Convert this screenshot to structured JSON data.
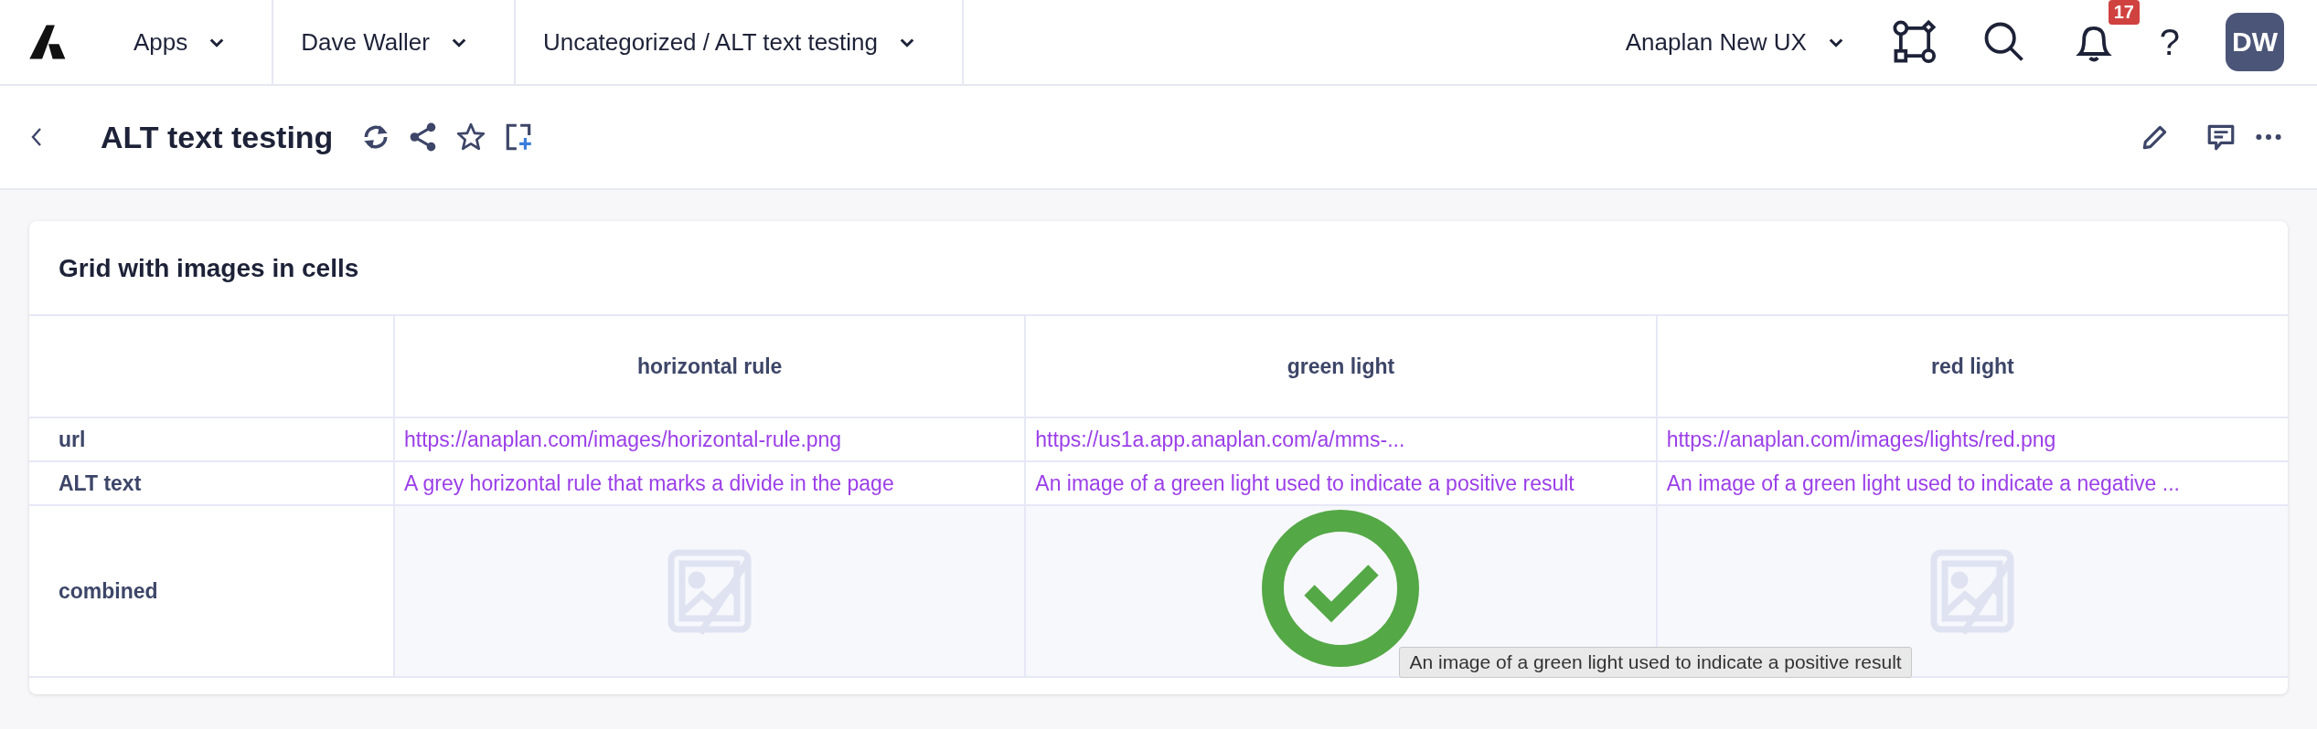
{
  "top_bar": {
    "breadcrumbs": [
      {
        "label": "Apps"
      },
      {
        "label": "Dave Waller"
      },
      {
        "label": "Uncategorized / ALT text testing"
      }
    ],
    "workspace": {
      "label": "Anaplan New UX"
    },
    "notifications": {
      "count": "17"
    },
    "help": {
      "label": "?"
    },
    "avatar": {
      "initials": "DW"
    }
  },
  "page_header": {
    "title": "ALT text testing"
  },
  "card": {
    "title": "Grid with images in cells",
    "table": {
      "columns": [
        "horizontal rule",
        "green light",
        "red light"
      ],
      "rows": [
        {
          "label": "url",
          "cells": [
            {
              "kind": "link",
              "text": "https://anaplan.com/images/horizontal-rule.png"
            },
            {
              "kind": "link",
              "text": "https://us1a.app.anaplan.com/a/mms-..."
            },
            {
              "kind": "link",
              "text": "https://anaplan.com/images/lights/red.png"
            }
          ]
        },
        {
          "label": "ALT text",
          "cells": [
            {
              "kind": "link",
              "text": "A grey horizontal rule that marks a divide in the page"
            },
            {
              "kind": "link",
              "text": "An image of a green light used to indicate a positive result"
            },
            {
              "kind": "link",
              "text": "An image of a green light used to indicate a negative ..."
            }
          ]
        },
        {
          "label": "combined",
          "cells": [
            {
              "kind": "broken-image"
            },
            {
              "kind": "check-image",
              "tooltip": "An image of a green light used to indicate a positive result"
            },
            {
              "kind": "broken-image"
            }
          ]
        }
      ]
    }
  }
}
